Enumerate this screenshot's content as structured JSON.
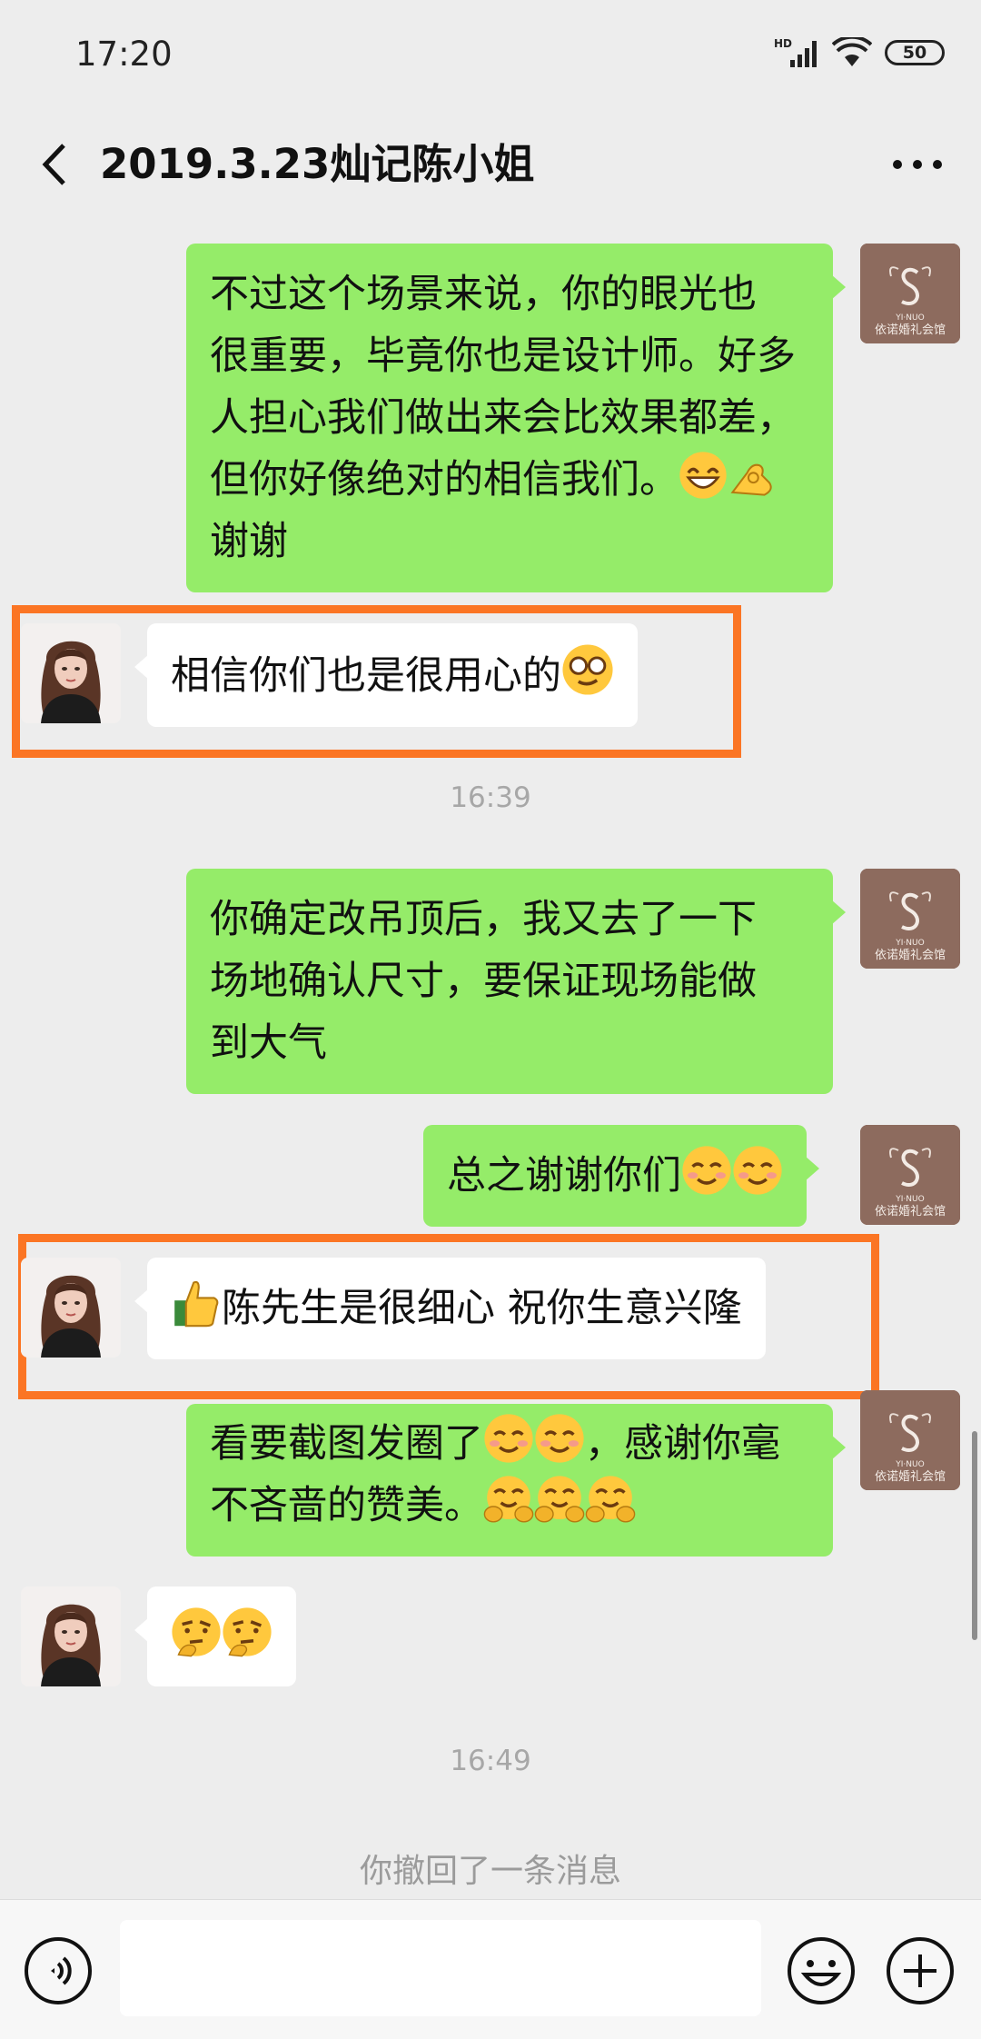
{
  "status_bar": {
    "time": "17:20",
    "network": "HD",
    "battery": "50"
  },
  "header": {
    "title": "2019.3.23灿记陈小姐"
  },
  "brand_avatar": {
    "brand_latin": "YI·NUO",
    "brand_cn": "依诺婚礼会馆"
  },
  "messages": [
    {
      "sender": "me",
      "lines": [
        "不过这个场景来说，你的眼光也",
        "很重要，毕竟你也是设计师。好多",
        "人担心我们做出来会比效果都差，",
        "但你好像绝对的相信我们。",
        "谢谢"
      ]
    },
    {
      "sender": "peer",
      "text": "相信你们也是很用心的"
    },
    {
      "time": "16:39"
    },
    {
      "sender": "me",
      "lines": [
        "你确定改吊顶后，我又去了一下",
        "场地确认尺寸，要保证现场能做",
        "到大气"
      ]
    },
    {
      "sender": "me",
      "text": "总之谢谢你们"
    },
    {
      "sender": "peer",
      "text": "陈先生是很细心 祝你生意兴隆"
    },
    {
      "sender": "me",
      "lines": [
        "看要截图发圈了",
        "，感谢你毫",
        "不吝啬的赞美。"
      ]
    },
    {
      "sender": "peer",
      "text": ""
    },
    {
      "time": "16:49"
    },
    {
      "system": "你撤回了一条消息"
    }
  ],
  "input_bar": {
    "placeholder": ""
  },
  "colors": {
    "my_bubble": "#95ec69",
    "peer_bubble": "#ffffff",
    "highlight": "#fb7524",
    "background": "#ededed"
  },
  "icons": [
    "back-arrow-icon",
    "more-icon",
    "signal-icon",
    "wifi-icon",
    "battery-icon",
    "voice-icon",
    "emoji-icon",
    "plus-icon"
  ]
}
